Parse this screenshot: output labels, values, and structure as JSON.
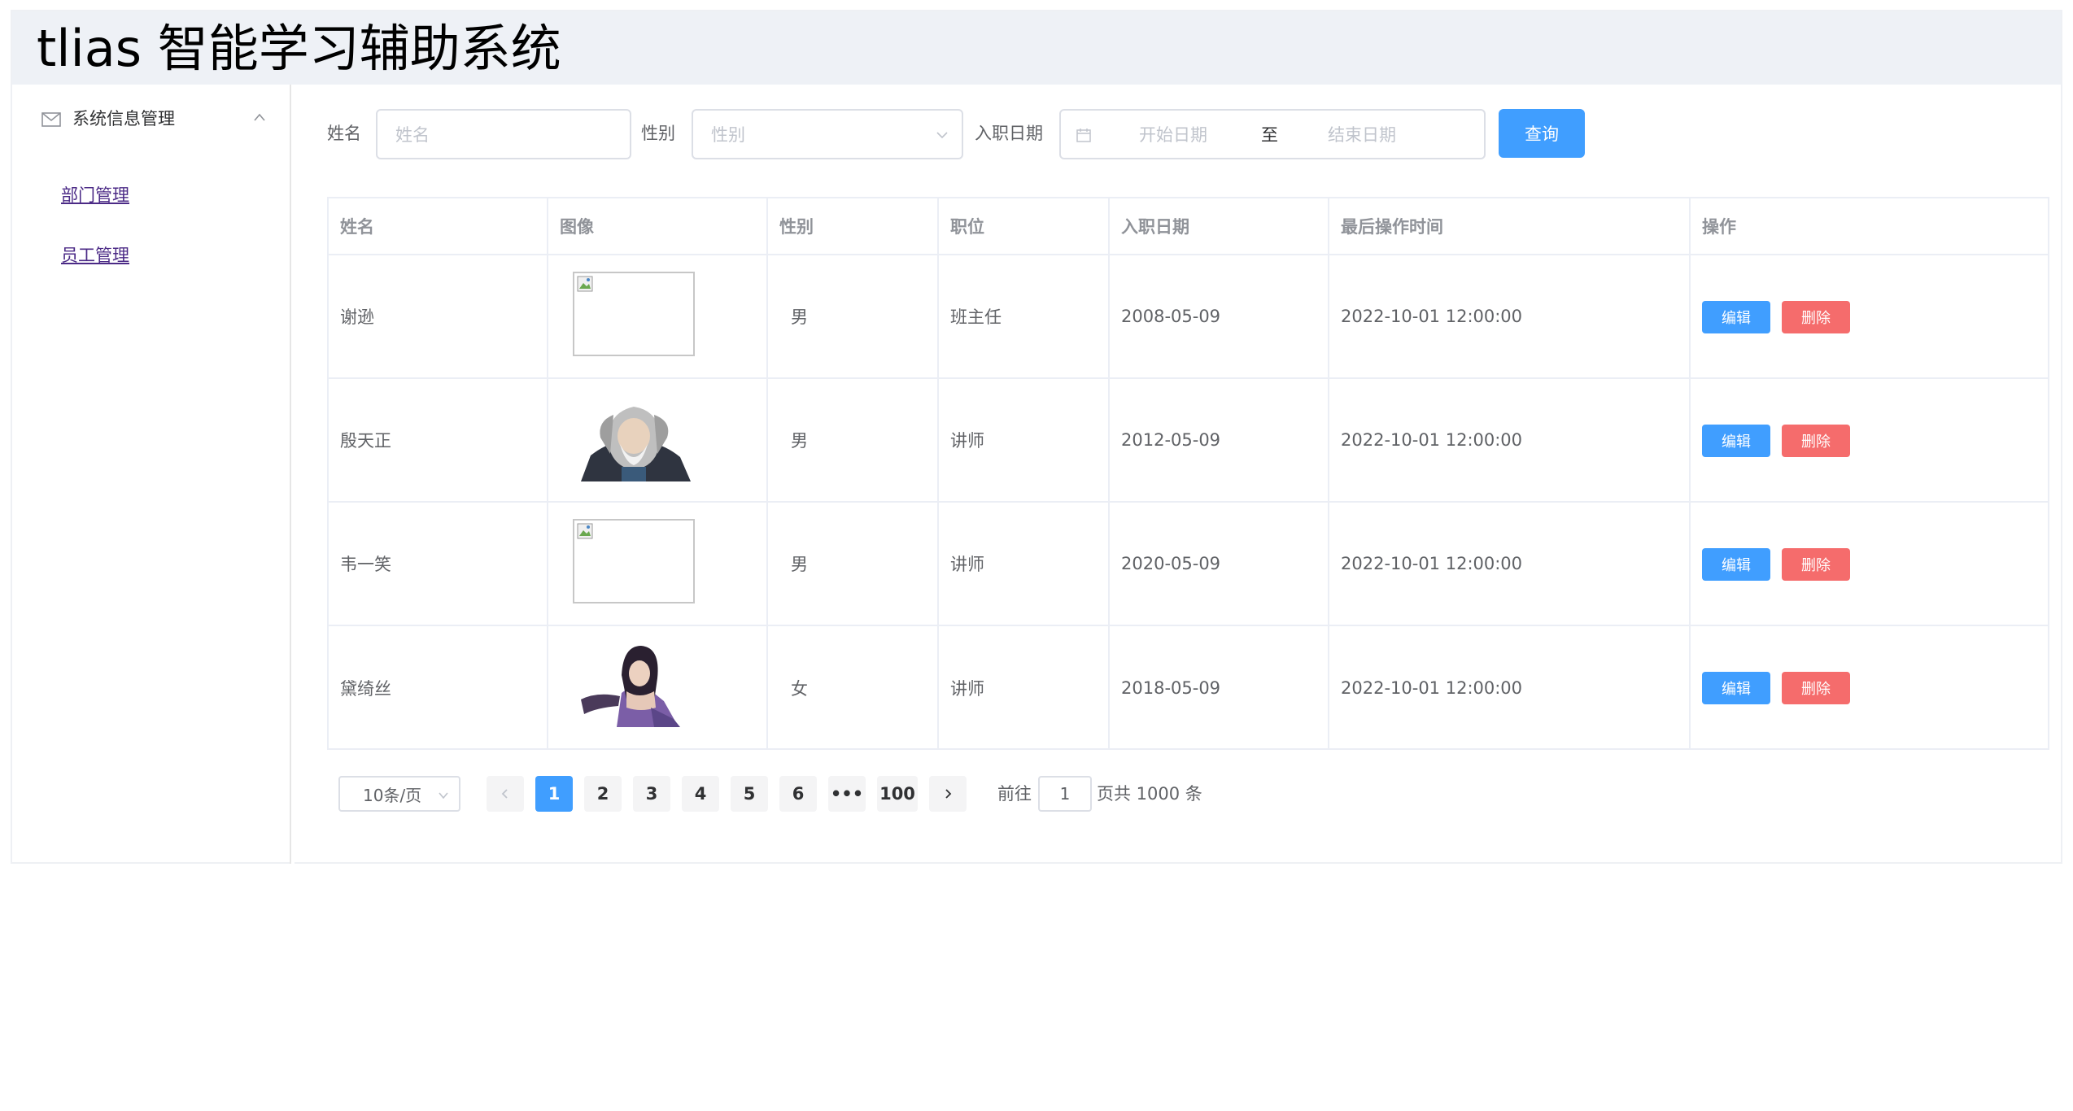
{
  "header": {
    "title": "tlias 智能学习辅助系统"
  },
  "sidebar": {
    "group": {
      "label": "系统信息管理",
      "icon": "mail-icon"
    },
    "items": [
      {
        "label": "部门管理"
      },
      {
        "label": "员工管理"
      }
    ]
  },
  "search": {
    "name_label": "姓名",
    "name_placeholder": "姓名",
    "gender_label": "性别",
    "gender_placeholder": "性别",
    "date_label": "入职日期",
    "date_start_placeholder": "开始日期",
    "date_separator": "至",
    "date_end_placeholder": "结束日期",
    "query_button": "查询"
  },
  "table": {
    "headers": [
      "姓名",
      "图像",
      "性别",
      "职位",
      "入职日期",
      "最后操作时间",
      "操作"
    ],
    "rows": [
      {
        "name": "谢逊",
        "image": "broken",
        "gender": "男",
        "position": "班主任",
        "entry_date": "2008-05-09",
        "update_time": "2022-10-01 12:00:00"
      },
      {
        "name": "殷天正",
        "image": "avatar-old-man",
        "gender": "男",
        "position": "讲师",
        "entry_date": "2012-05-09",
        "update_time": "2022-10-01 12:00:00"
      },
      {
        "name": "韦一笑",
        "image": "broken",
        "gender": "男",
        "position": "讲师",
        "entry_date": "2020-05-09",
        "update_time": "2022-10-01 12:00:00"
      },
      {
        "name": "黛绮丝",
        "image": "avatar-woman",
        "gender": "女",
        "position": "讲师",
        "entry_date": "2018-05-09",
        "update_time": "2022-10-01 12:00:00"
      }
    ],
    "edit_label": "编辑",
    "delete_label": "删除"
  },
  "pagination": {
    "page_size": "10条/页",
    "pages": [
      "1",
      "2",
      "3",
      "4",
      "5",
      "6",
      "•••",
      "100"
    ],
    "current": "1",
    "goto_label": "前往",
    "goto_value": "1",
    "total_text": "页共 1000 条"
  },
  "colors": {
    "primary": "#409eff",
    "danger": "#f56c6c",
    "header_bg": "#eef1f6"
  }
}
